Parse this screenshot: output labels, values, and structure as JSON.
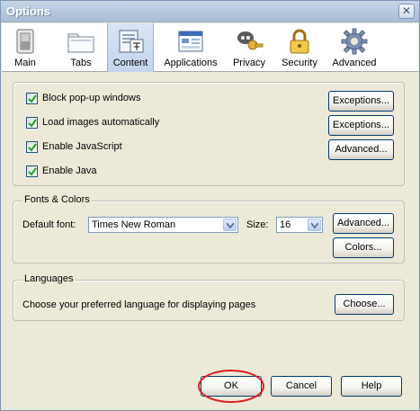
{
  "window": {
    "title": "Options",
    "close_glyph": "✕"
  },
  "toolbar": {
    "items": [
      {
        "label": "Main",
        "icon": "switch-icon"
      },
      {
        "label": "Tabs",
        "icon": "folder-tabs-icon"
      },
      {
        "label": "Content",
        "icon": "document-icon",
        "selected": true
      },
      {
        "label": "Applications",
        "icon": "application-window-icon"
      },
      {
        "label": "Privacy",
        "icon": "mask-key-icon"
      },
      {
        "label": "Security",
        "icon": "padlock-icon"
      },
      {
        "label": "Advanced",
        "icon": "gear-icon"
      }
    ]
  },
  "content": {
    "checkboxes": [
      {
        "label": "Block pop-up windows",
        "checked": true
      },
      {
        "label": "Load images automatically",
        "checked": true
      },
      {
        "label": "Enable JavaScript",
        "checked": true
      },
      {
        "label": "Enable Java",
        "checked": true
      }
    ],
    "buttons": {
      "exceptions_popups": "Exceptions...",
      "exceptions_images": "Exceptions...",
      "advanced_js": "Advanced..."
    }
  },
  "fonts": {
    "title": "Fonts & Colors",
    "default_font_label": "Default font:",
    "default_font_value": "Times New Roman",
    "size_label": "Size:",
    "size_value": "16",
    "advanced_button": "Advanced...",
    "colors_button": "Colors..."
  },
  "languages": {
    "title": "Languages",
    "description": "Choose your preferred language for displaying pages",
    "choose_button": "Choose..."
  },
  "footer": {
    "ok": "OK",
    "cancel": "Cancel",
    "help": "Help"
  },
  "colors": {
    "highlight": "#d9201e",
    "selected_tab": "#c3d4ec"
  }
}
